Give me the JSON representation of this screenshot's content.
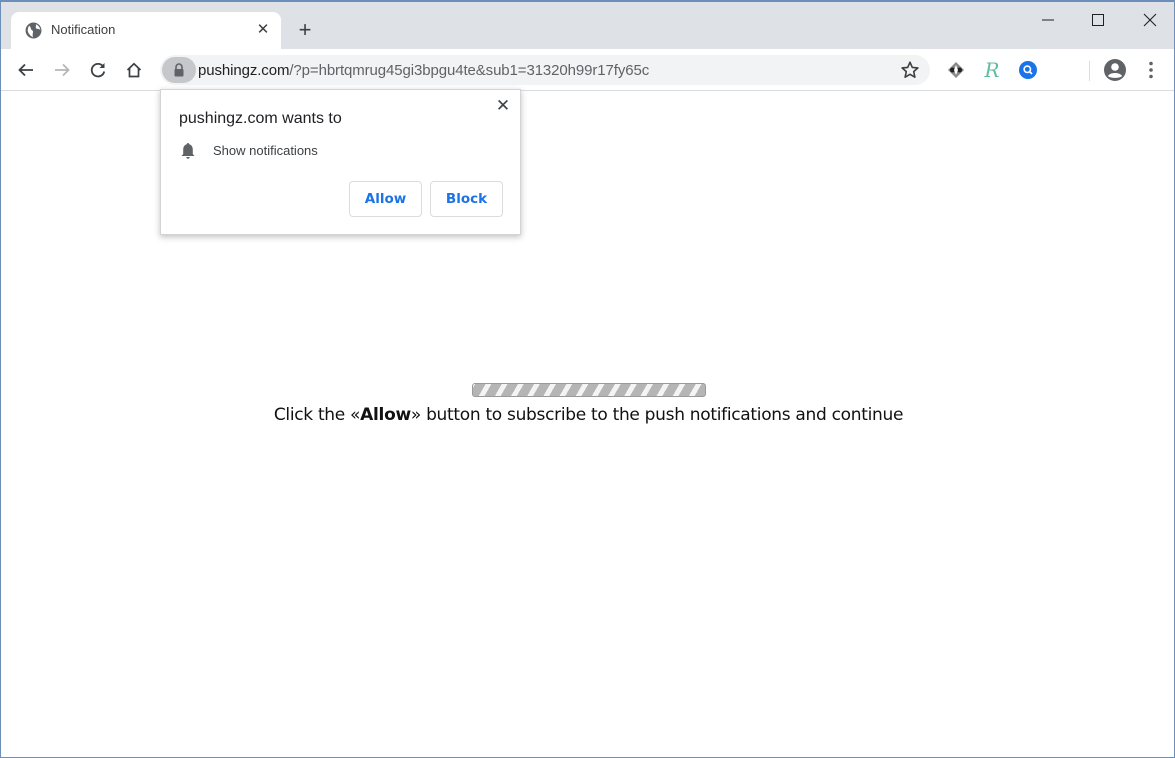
{
  "browser": {
    "tab": {
      "title": "Notification",
      "favicon": "globe-icon"
    },
    "new_tab_label": "+",
    "window_controls": [
      "minimize-icon",
      "maximize-icon",
      "close-icon"
    ],
    "nav": [
      "back-icon",
      "forward-icon",
      "reload-icon",
      "home-icon"
    ],
    "omnibox": {
      "domain": "pushingz.com",
      "path": "/?p=hbrtqmrug45gi3bpgu4te&sub1=31320h99r17fy65c",
      "lock_icon": "lock-icon",
      "bookmark_icon": "star-icon"
    },
    "extensions": [
      "extension-diamond-icon",
      "extension-r-icon",
      "extension-search-icon"
    ],
    "profile_icon": "account-icon",
    "menu_icon": "kebab-menu-icon"
  },
  "permission_popup": {
    "title": "pushingz.com wants to",
    "permission": "Show notifications",
    "permission_icon": "bell-icon",
    "allow_label": "Allow",
    "block_label": "Block",
    "close_label": "✕"
  },
  "page": {
    "message_before": "Click the «",
    "message_bold": "Allow",
    "message_after": "» button to subscribe to the push notifications and continue",
    "progress_style": "indeterminate-striped"
  },
  "colors": {
    "accent": "#1a73e8",
    "tabstrip": "#dee1e6",
    "omnibox": "#f1f3f4"
  }
}
